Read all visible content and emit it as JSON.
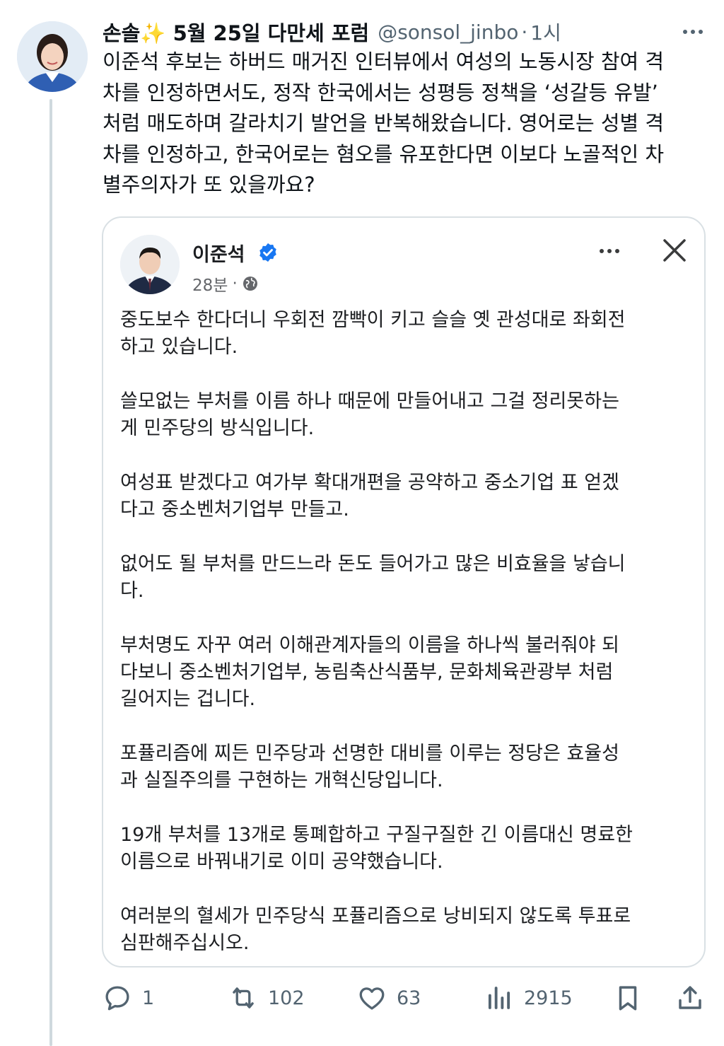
{
  "tweet": {
    "author_name": "손솔",
    "author_emoji": "✨",
    "author_tagline": "5월 25일 다만세 포럼",
    "handle": "@sonsol_jinbo",
    "separator": "·",
    "time": "1시",
    "text_lines": [
      "이준석 후보는 하버드 매거진 인터뷰에서 여성의 노동시장 참여 격",
      "차를 인정하면서도, 정작 한국에서는 성평등 정책을 ‘성갈등 유발’",
      "처럼 매도하며 갈라치기 발언을 반복해왔습니다. 영어로는 성별 격",
      "차를 인정하고, 한국어로는 혐오를 유포한다면 이보다 노골적인 차",
      "별주의자가 또 있을까요?"
    ]
  },
  "quoted_post": {
    "author_name": "이준석",
    "time": "28분",
    "separator": "·",
    "paragraphs": [
      [
        "중도보수 한다더니 우회전 깜빡이 키고 슬슬 옛 관성대로 좌회전",
        "하고 있습니다."
      ],
      [
        "쓸모없는 부처를 이름 하나 때문에 만들어내고 그걸 정리못하는",
        "게 민주당의 방식입니다."
      ],
      [
        "여성표 받겠다고 여가부 확대개편을 공약하고 중소기업 표 얻겠",
        "다고 중소벤처기업부 만들고."
      ],
      [
        "없어도 될 부처를 만드느라 돈도 들어가고 많은 비효율을 낳습니",
        "다."
      ],
      [
        "부처명도 자꾸 여러 이해관계자들의 이름을 하나씩 불러줘야 되",
        "다보니 중소벤처기업부, 농림축산식품부, 문화체육관광부 처럼",
        "길어지는 겁니다."
      ],
      [
        "포퓰리즘에 찌든 민주당과 선명한 대비를 이루는 정당은 효율성",
        "과 실질주의를 구현하는 개혁신당입니다."
      ],
      [
        "19개 부처를 13개로 통폐합하고 구질구질한 긴 이름대신 명료한",
        "이름으로 바꿔내기로 이미 공약했습니다."
      ],
      [
        "여러분의 혈세가 민주당식 포퓰리즘으로 낭비되지 않도록 투표로",
        "심판해주십시오."
      ]
    ]
  },
  "actions": {
    "replies": "1",
    "reposts": "102",
    "likes": "63",
    "views": "2915"
  },
  "icons": {
    "more": "more-horizontal-icon",
    "verified": "verified-badge-icon",
    "globe": "globe-icon",
    "close": "close-icon",
    "reply": "reply-icon",
    "repost": "repost-icon",
    "like": "heart-icon",
    "views": "views-chart-icon",
    "bookmark": "bookmark-icon",
    "share": "share-icon"
  },
  "colors": {
    "text": "#0f1419",
    "secondary": "#536471",
    "verified": "#1877f2",
    "border": "#d9e0e4"
  }
}
